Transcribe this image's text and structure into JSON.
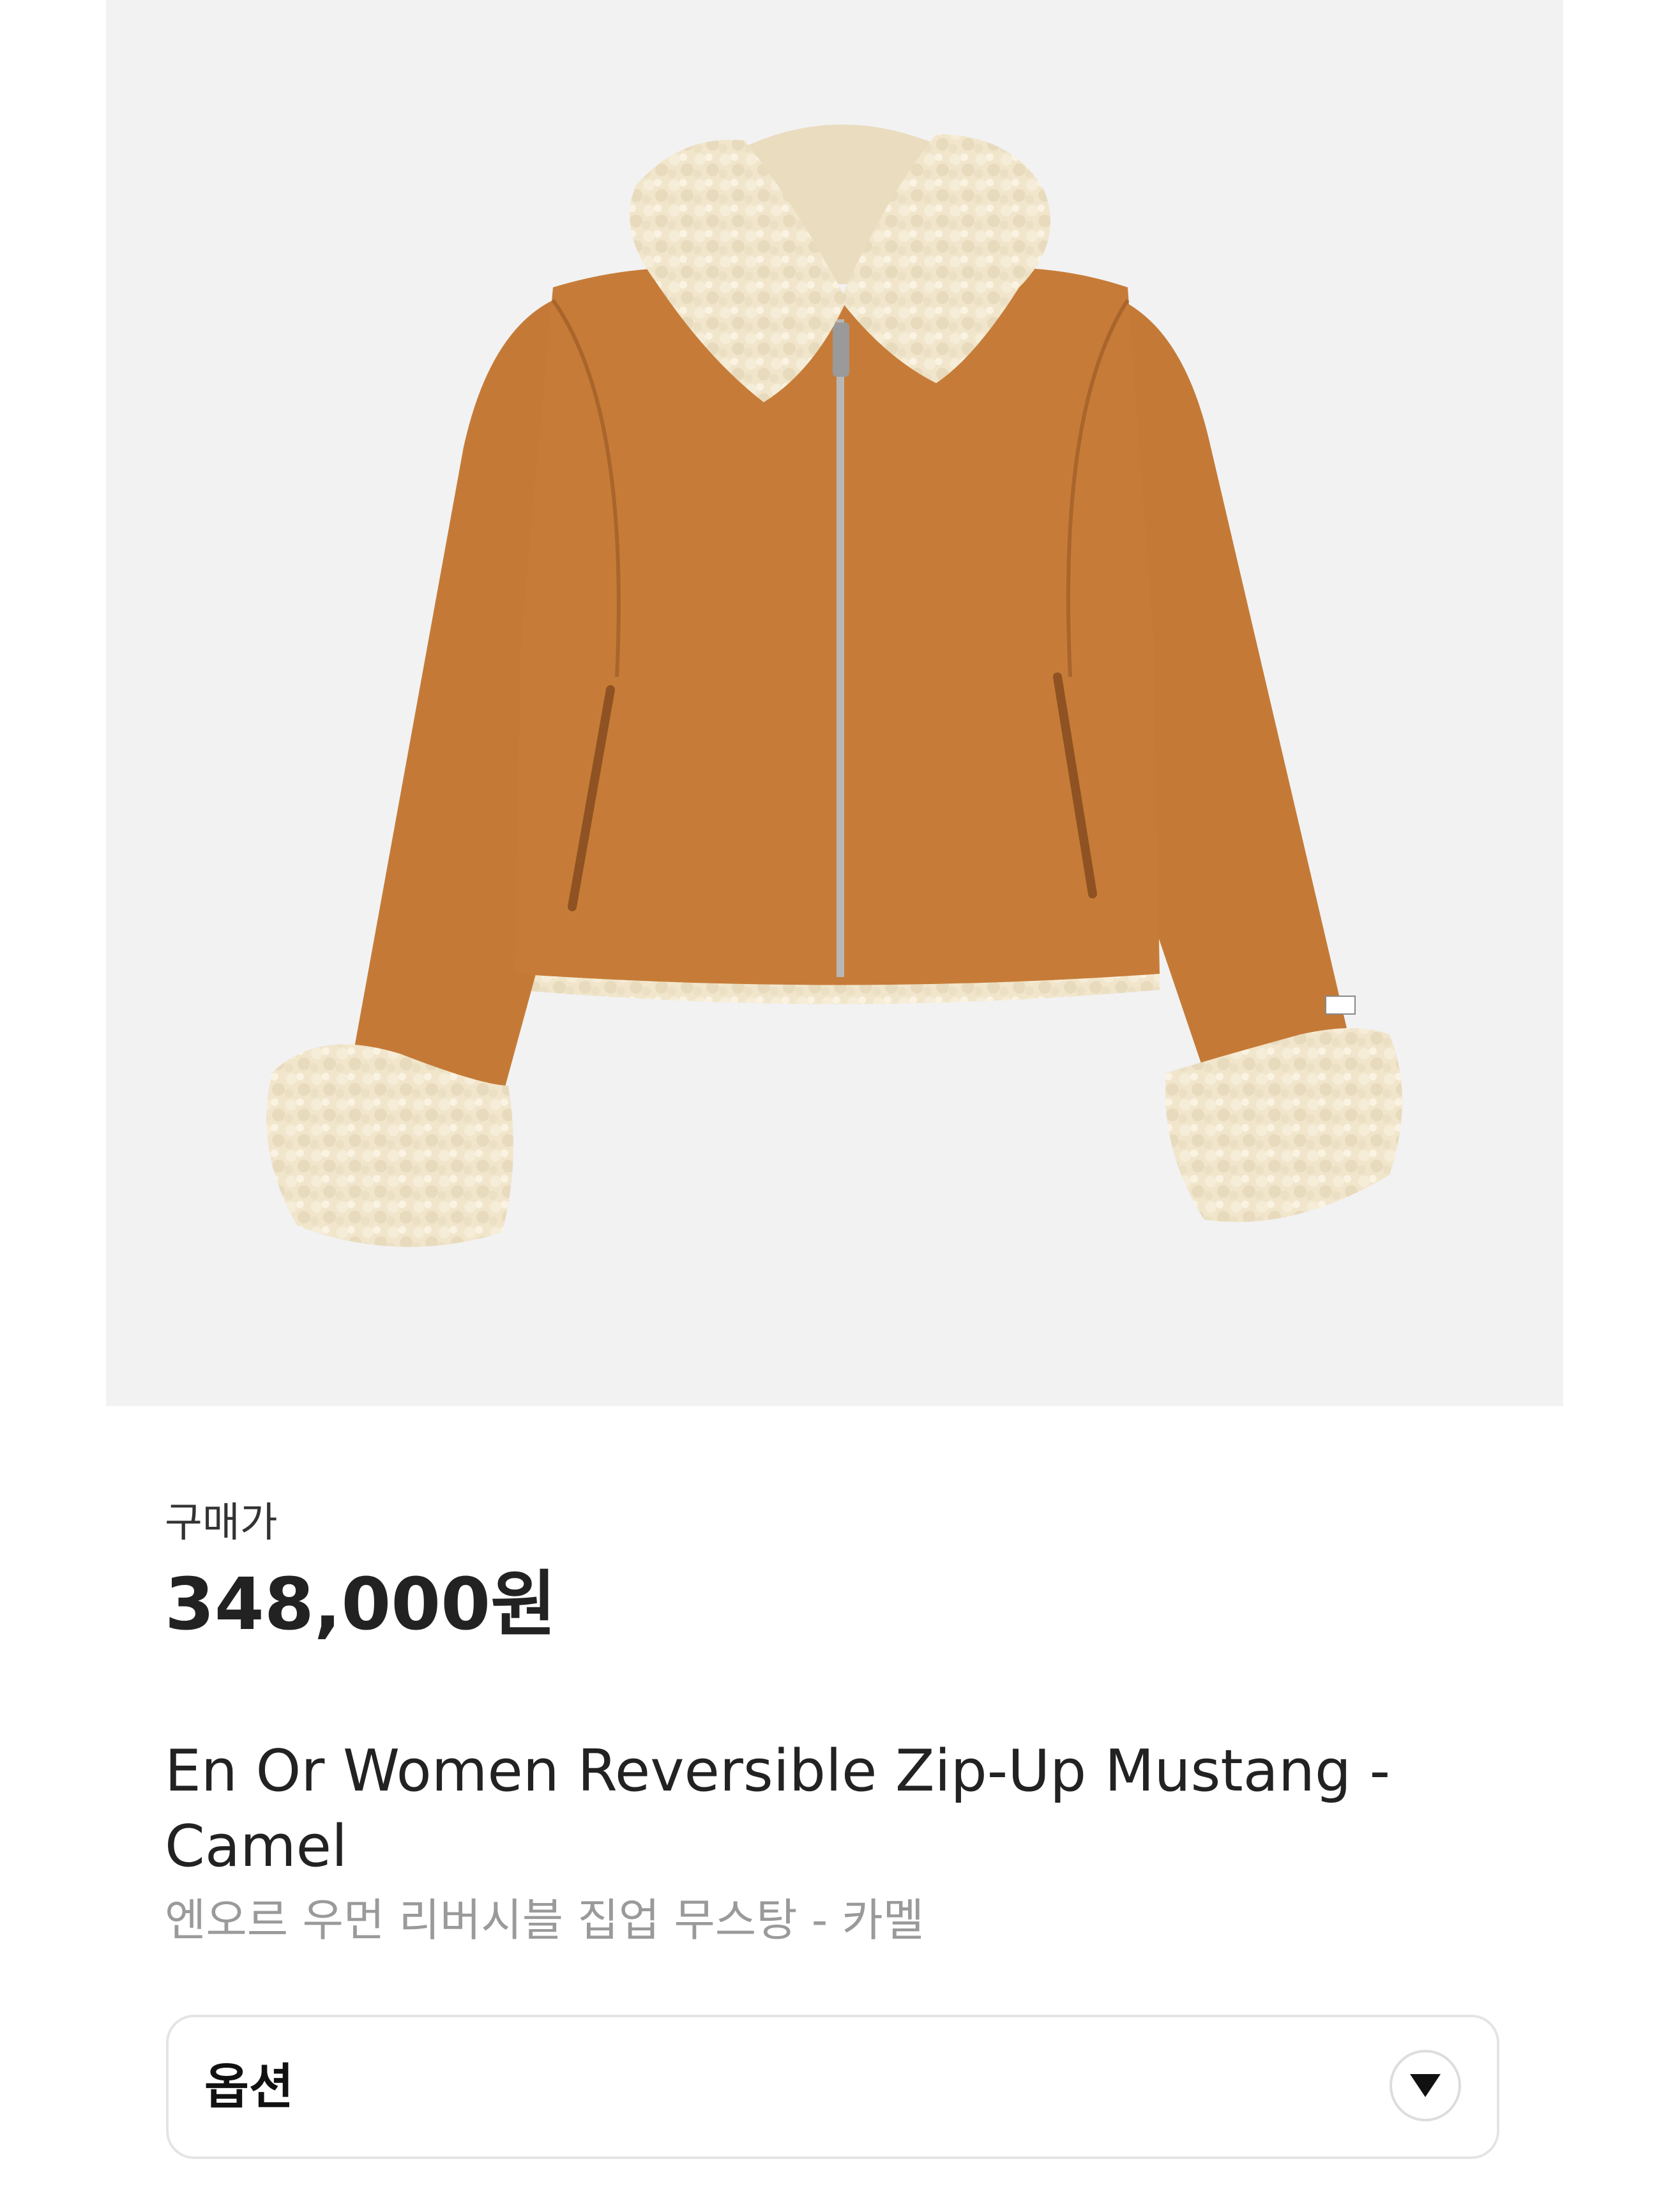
{
  "product": {
    "price_label": "구매가",
    "price": "348,000원",
    "name_en": "En Or Women Reversible Zip-Up Mustang - Camel",
    "name_kr": "엔오르 우먼 리버시블 집업 무스탕 - 카멜"
  },
  "options": {
    "label": "옵션",
    "arrow_icon": "chevron-down-icon"
  },
  "image": {
    "alt": "camel suede shearling jacket",
    "background_color": "#f2f2f3",
    "suede_color": "#c47a36",
    "shearling_color": "#f1e6cc"
  }
}
